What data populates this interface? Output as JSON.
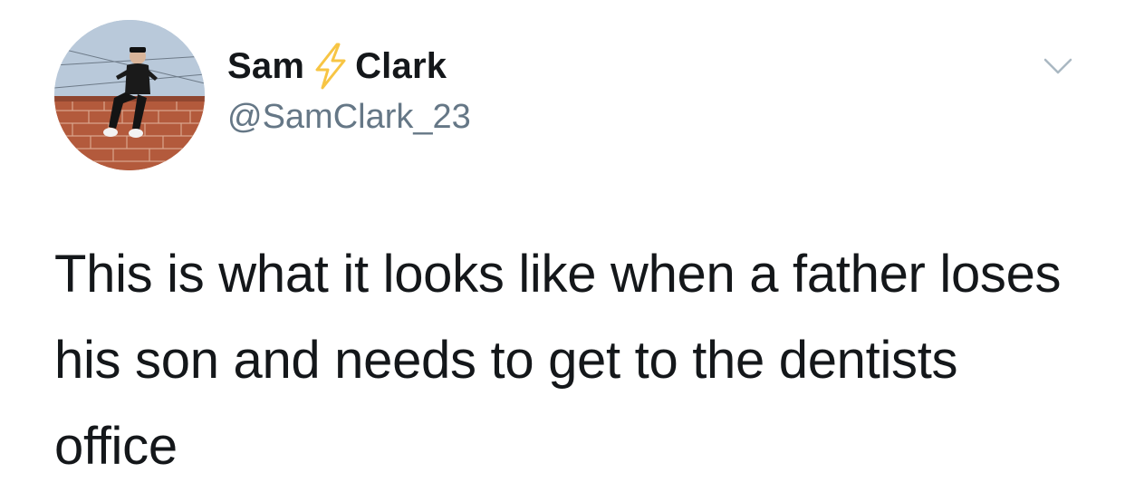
{
  "user": {
    "name_first": "Sam",
    "name_emoji": "lightning-bolt-icon",
    "name_last": "Clark",
    "handle": "@SamClark_23",
    "avatar": "avatar-photo"
  },
  "tweet": {
    "text": "This is what it looks like when a father loses his son and needs to get to the dentists office"
  },
  "menu": {
    "icon": "chevron-down-icon"
  },
  "colors": {
    "text": "#14171a",
    "secondary": "#657786",
    "bolt": "#f7c544",
    "chevron": "#aab8c2"
  }
}
